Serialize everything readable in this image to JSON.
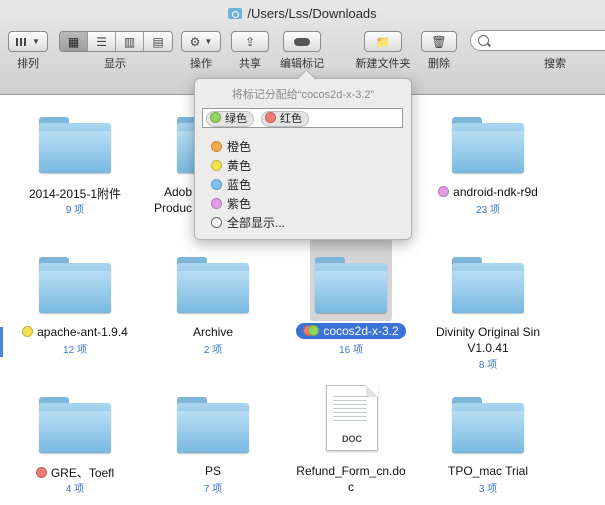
{
  "window": {
    "title": "/Users/Lss/Downloads"
  },
  "toolbar": {
    "arrange_label": "排列",
    "view_label": "显示",
    "action_label": "操作",
    "share_label": "共享",
    "tags_label": "编辑标记",
    "new_folder_label": "新建文件夹",
    "delete_label": "删除",
    "search_label": "搜索",
    "search_placeholder": ""
  },
  "popover": {
    "title": "将标记分配给“cocos2d-x-3.2”",
    "assigned": [
      {
        "label": "绿色",
        "color": "#8fd65c"
      },
      {
        "label": "红色",
        "color": "#ef7b76"
      }
    ],
    "options": [
      {
        "label": "橙色",
        "color": "#f6ab4a"
      },
      {
        "label": "黄色",
        "color": "#f3e24a"
      },
      {
        "label": "蓝色",
        "color": "#7fc0f2"
      },
      {
        "label": "紫色",
        "color": "#e29be6"
      }
    ],
    "show_all": "全部显示..."
  },
  "files": [
    {
      "name": "2014-2015-1附件",
      "count": "9 项"
    },
    {
      "name": "Adob",
      "name2": "Produc",
      "count": ""
    },
    {
      "name": "",
      "count": ""
    },
    {
      "name": "android-ndk-r9d",
      "count": "23 项",
      "tag": "#e29be6"
    },
    {
      "name": "apache-ant-1.9.4",
      "count": "12 项",
      "tag": "#f3e24a"
    },
    {
      "name": "Archive",
      "count": "2 项"
    },
    {
      "name": "cocos2d-x-3.2",
      "count": "16 项",
      "tag": "#ef7b76",
      "tag2": "#8fd65c"
    },
    {
      "name": "Divinity Original Sin",
      "name2": "V1.0.41",
      "count": "8 项"
    },
    {
      "name": "GRE、Toefl",
      "count": "4 项",
      "tag": "#ef7b76"
    },
    {
      "name": "PS",
      "count": "7 项"
    },
    {
      "name": "Refund_Form_cn.do",
      "name2": "c",
      "count": "",
      "doc_label": "DOC"
    },
    {
      "name": "TPO_mac Trial",
      "count": "3 项"
    }
  ]
}
